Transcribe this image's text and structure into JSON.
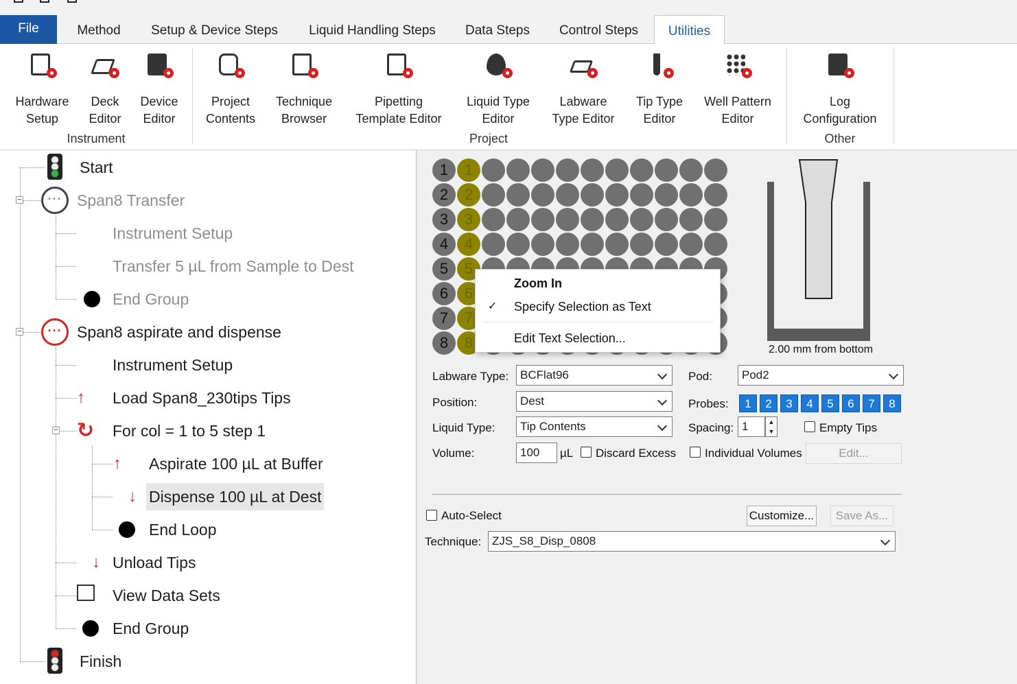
{
  "ribbon_tabs": [
    "File",
    "Method",
    "Setup & Device Steps",
    "Liquid Handling Steps",
    "Data Steps",
    "Control Steps",
    "Utilities"
  ],
  "ribbon": {
    "buttons": [
      {
        "l1": "Hardware",
        "l2": "Setup",
        "icon": "hardware-setup-icon"
      },
      {
        "l1": "Deck",
        "l2": "Editor",
        "icon": "deck-editor-icon"
      },
      {
        "l1": "Device",
        "l2": "Editor",
        "icon": "device-editor-icon"
      },
      {
        "l1": "Project",
        "l2": "Contents",
        "icon": "project-contents-icon"
      },
      {
        "l1": "Technique",
        "l2": "Browser",
        "icon": "technique-browser-icon"
      },
      {
        "l1": "Pipetting",
        "l2": "Template Editor",
        "icon": "pipetting-template-icon"
      },
      {
        "l1": "Liquid Type",
        "l2": "Editor",
        "icon": "liquid-type-icon"
      },
      {
        "l1": "Labware",
        "l2": "Type Editor",
        "icon": "labware-type-icon"
      },
      {
        "l1": "Tip Type",
        "l2": "Editor",
        "icon": "tip-type-icon"
      },
      {
        "l1": "Well Pattern",
        "l2": "Editor",
        "icon": "well-pattern-icon"
      },
      {
        "l1": "Log",
        "l2": "Configuration",
        "icon": "log-configuration-icon"
      }
    ],
    "groups": [
      "Instrument",
      "Project",
      "Other"
    ]
  },
  "tree": [
    {
      "label": "Start"
    },
    {
      "label": "Span8 Transfer"
    },
    {
      "label": "Instrument Setup"
    },
    {
      "label": "Transfer 5 µL from Sample to Dest"
    },
    {
      "label": "End Group"
    },
    {
      "label": "Span8 aspirate and dispense"
    },
    {
      "label": "Instrument Setup"
    },
    {
      "label": "Load Span8_230tips Tips"
    },
    {
      "label": "For col = 1 to 5 step 1"
    },
    {
      "label": "Aspirate 100 µL at Buffer"
    },
    {
      "label": "Dispense 100 µL at Dest"
    },
    {
      "label": "End Loop"
    },
    {
      "label": "Unload Tips"
    },
    {
      "label": "View Data Sets"
    },
    {
      "label": "End Group"
    },
    {
      "label": "Finish"
    }
  ],
  "plate": {
    "rows": [
      "1",
      "2",
      "3",
      "4",
      "5",
      "6",
      "7",
      "8"
    ],
    "cols": 12,
    "selected_col": 2
  },
  "context_menu": {
    "zoom": "Zoom In",
    "specify": "Specify Selection as Text",
    "edit": "Edit Text Selection..."
  },
  "tip_caption": "2.00 mm from bottom",
  "form": {
    "labware_type_label": "Labware Type:",
    "labware_type": "BCFlat96",
    "position_label": "Position:",
    "position": "Dest",
    "liquid_type_label": "Liquid Type:",
    "liquid_type": "Tip Contents",
    "volume_label": "Volume:",
    "volume": "100",
    "volume_unit": "µL",
    "discard_excess": "Discard Excess",
    "pod_label": "Pod:",
    "pod": "Pod2",
    "probes_label": "Probes:",
    "probes": [
      "1",
      "2",
      "3",
      "4",
      "5",
      "6",
      "7",
      "8"
    ],
    "spacing_label": "Spacing:",
    "spacing": "1",
    "empty_tips": "Empty Tips",
    "individual_volumes": "Individual Volumes",
    "edit": "Edit...",
    "auto_select": "Auto-Select",
    "customize": "Customize...",
    "save_as": "Save As...",
    "technique_label": "Technique:",
    "technique": "ZJS_S8_Disp_0808"
  }
}
